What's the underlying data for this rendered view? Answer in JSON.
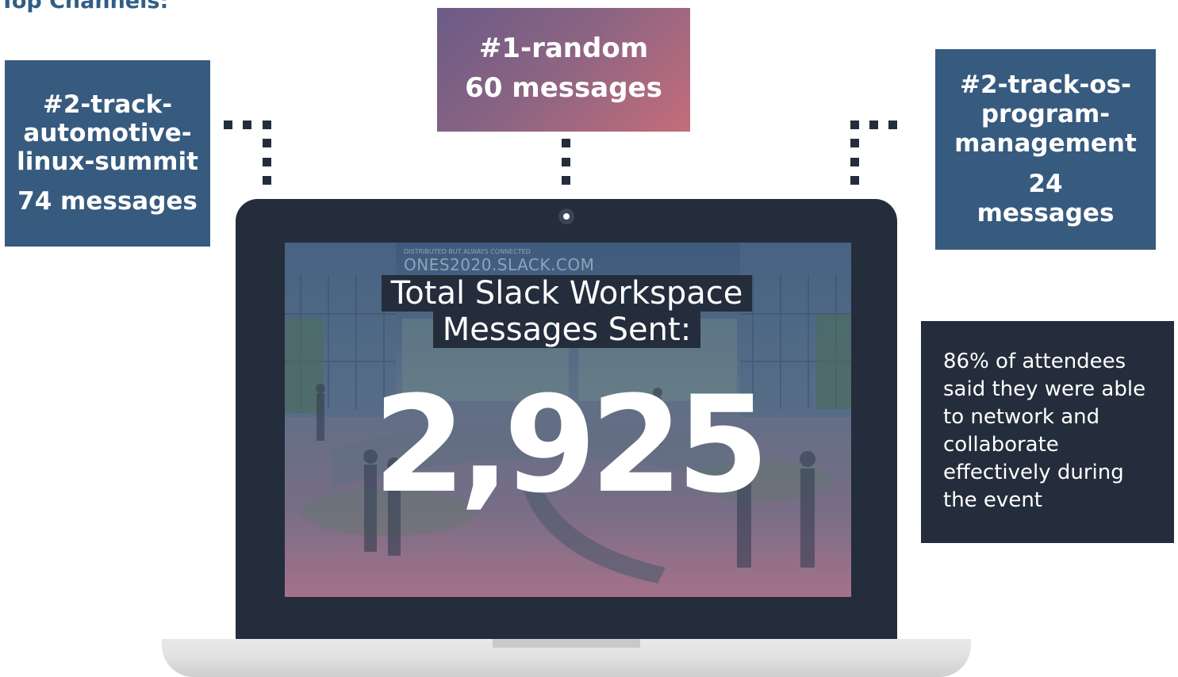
{
  "heading": "Top Channels:",
  "channels": [
    {
      "name": "#2-track-automotive-linux-summit",
      "messages": "74 messages"
    },
    {
      "name": "#1-random",
      "messages": "60 messages"
    },
    {
      "name": "#2-track-os-program-management",
      "messages": "24 messages"
    }
  ],
  "screen": {
    "sign_small": "DISTRIBUTED BUT ALWAYS CONNECTED",
    "sign_big": "ONES2020.SLACK.COM",
    "title_line1": "Total Slack Workspace",
    "title_line2": "Messages Sent:",
    "total": "2,925"
  },
  "stat": "86% of attendees said they were able to network and collaborate effectively during the event",
  "colors": {
    "brand_blue": "#375a7f",
    "dark_navy": "#242d3b",
    "gradient_start": "#6b5b86",
    "gradient_end": "#c46d7a"
  }
}
